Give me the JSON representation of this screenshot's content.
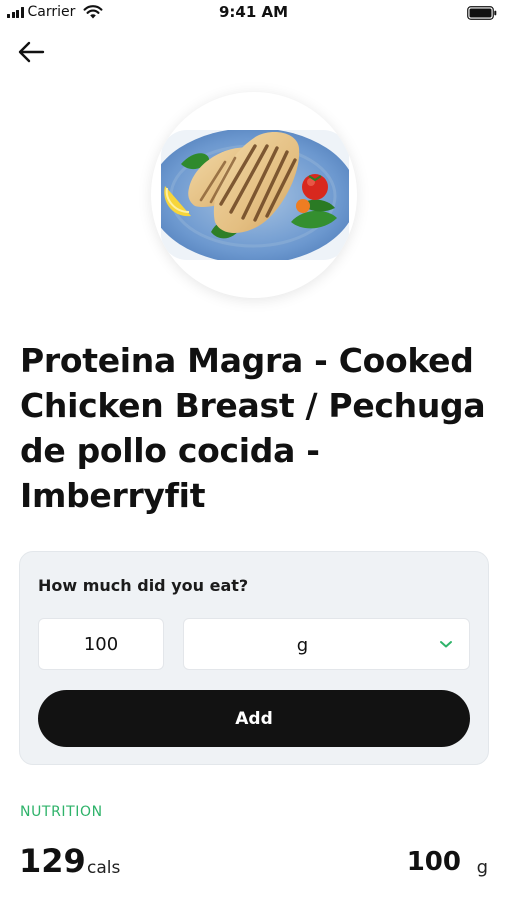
{
  "status_bar": {
    "carrier": "Carrier",
    "time": "9:41 AM"
  },
  "icons": {
    "back": "arrow-left-icon",
    "signal": "signal-icon",
    "wifi": "wifi-icon",
    "battery": "battery-icon",
    "chevron": "chevron-down-icon"
  },
  "food": {
    "image": "grilled-chicken-breast-photo",
    "title": "Proteina Magra - Cooked Chicken Breast / Pechuga de pollo cocida - Imberryfit"
  },
  "portion": {
    "question": "How much did you eat?",
    "quantity": "100",
    "unit": "g",
    "add_label": "Add"
  },
  "nutrition": {
    "section_label": "NUTRITION",
    "calories": "129",
    "calories_unit": "cals",
    "amount": "100",
    "amount_unit": "g"
  },
  "colors": {
    "accent_green": "#2fb36a",
    "button_black": "#121212",
    "card_background": "#eff2f5"
  }
}
